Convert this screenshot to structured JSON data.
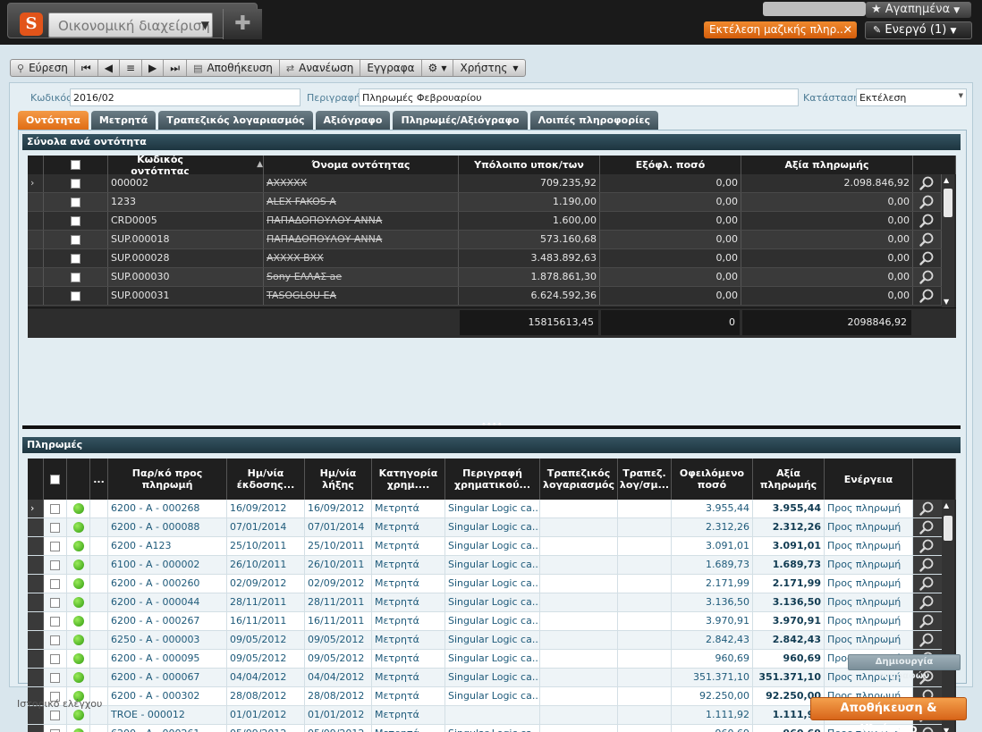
{
  "app": {
    "module_select": "Οικονομική διαχείριση",
    "favorites_label": "★ Αγαπημένα",
    "open_tab_label": "Εκτέλεση μαζικής πληρ...",
    "active_label": "Ενεργό (1)"
  },
  "toolbar": {
    "find": "Εύρεση",
    "save": "Αποθήκευση",
    "refresh": "Ανανέωση",
    "documents": "Εγγραφα",
    "user": "Χρήστης"
  },
  "form": {
    "code_label": "Κωδικός",
    "code_value": "2016/02",
    "desc_label": "Περιγραφή",
    "desc_value": "Πληρωμές Φεβρουαρίου",
    "status_label": "Κατάσταση",
    "status_value": "Εκτέλεση"
  },
  "tabs": [
    "Οντότητα",
    "Μετρητά",
    "Τραπεζικός λογαριασμός",
    "Αξιόγραφο",
    "Πληρωμές/Αξιόγραφο",
    "Λοιπές πληροφορίες"
  ],
  "entities": {
    "title": "Σύνολα ανά οντότητα",
    "columns": [
      "Κωδικός οντότητας",
      "Όνομα οντότητας",
      "Υπόλοιπο υποκ/των",
      "Εξόφλ. ποσό",
      "Αξία πληρωμής"
    ],
    "sort_indicator": "▲",
    "rows": [
      {
        "code": "000002",
        "name": "ΑΧΧΧΧΧ",
        "balance": "709.235,92",
        "paid": "0,00",
        "value": "2.098.846,92"
      },
      {
        "code": "1233",
        "name": "ALEX FAKOS A",
        "balance": "1.190,00",
        "paid": "0,00",
        "value": "0,00"
      },
      {
        "code": "CRD0005",
        "name": "ΠΑΠΑΔΟΠΟΥΛΟΥ ΑΝΝΑ",
        "balance": "1.600,00",
        "paid": "0,00",
        "value": "0,00"
      },
      {
        "code": "SUP.000018",
        "name": "ΠΑΠΑΔΟΠΟΥΛΟΥ ΑΝΝΑ",
        "balance": "573.160,68",
        "paid": "0,00",
        "value": "0,00"
      },
      {
        "code": "SUP.000028",
        "name": "ΑΧΧΧΧ ΒΧΧ",
        "balance": "3.483.892,63",
        "paid": "0,00",
        "value": "0,00"
      },
      {
        "code": "SUP.000030",
        "name": "Sony ΕΛΛΑΣ ae",
        "balance": "1.878.861,30",
        "paid": "0,00",
        "value": "0,00"
      },
      {
        "code": "SUP.000031",
        "name": "TASOGLOU EA",
        "balance": "6.624.592,36",
        "paid": "0,00",
        "value": "0,00"
      }
    ],
    "totals": {
      "balance": "15815613,45",
      "paid": "0",
      "value": "2098846,92"
    }
  },
  "payments": {
    "title": "Πληρωμές",
    "columns": {
      "ellipsis": "...",
      "ref": "Παρ/κό προς πληρωμή",
      "issue": "Ημ/νία έκδοσης...",
      "expiry": "Ημ/νία λήξης",
      "category": "Κατηγορία χρημ....",
      "description": "Περιγραφή χρηματικού...",
      "bank": "Τραπεζικός λογαριασμός",
      "bankdesc": "Τραπεζ. λογ/σμ...",
      "owed": "Οφειλόμενο ποσό",
      "value": "Αξία πληρωμής",
      "action": "Ενέργεια"
    },
    "rows": [
      {
        "ref": "6200 - A - 000268",
        "issue": "16/09/2012",
        "expiry": "16/09/2012",
        "category": "Μετρητά",
        "description": "Singular Logic ca...",
        "owed": "3.955,44",
        "value": "3.955,44",
        "action": "Προς πληρωμή"
      },
      {
        "ref": "6200 - A - 000088",
        "issue": "07/01/2014",
        "expiry": "07/01/2014",
        "category": "Μετρητά",
        "description": "Singular Logic ca...",
        "owed": "2.312,26",
        "value": "2.312,26",
        "action": "Προς πληρωμή"
      },
      {
        "ref": "6200 - A123",
        "issue": "25/10/2011",
        "expiry": "25/10/2011",
        "category": "Μετρητά",
        "description": "Singular Logic ca...",
        "owed": "3.091,01",
        "value": "3.091,01",
        "action": "Προς πληρωμή"
      },
      {
        "ref": "6100 - A - 000002",
        "issue": "26/10/2011",
        "expiry": "26/10/2011",
        "category": "Μετρητά",
        "description": "Singular Logic ca...",
        "owed": "1.689,73",
        "value": "1.689,73",
        "action": "Προς πληρωμή"
      },
      {
        "ref": "6200 - A - 000260",
        "issue": "02/09/2012",
        "expiry": "02/09/2012",
        "category": "Μετρητά",
        "description": "Singular Logic ca...",
        "owed": "2.171,99",
        "value": "2.171,99",
        "action": "Προς πληρωμή"
      },
      {
        "ref": "6200 - A - 000044",
        "issue": "28/11/2011",
        "expiry": "28/11/2011",
        "category": "Μετρητά",
        "description": "Singular Logic ca...",
        "owed": "3.136,50",
        "value": "3.136,50",
        "action": "Προς πληρωμή"
      },
      {
        "ref": "6200 - A - 000267",
        "issue": "16/11/2011",
        "expiry": "16/11/2011",
        "category": "Μετρητά",
        "description": "Singular Logic ca...",
        "owed": "3.970,91",
        "value": "3.970,91",
        "action": "Προς πληρωμή"
      },
      {
        "ref": "6250 - A - 000003",
        "issue": "09/05/2012",
        "expiry": "09/05/2012",
        "category": "Μετρητά",
        "description": "Singular Logic ca...",
        "owed": "2.842,43",
        "value": "2.842,43",
        "action": "Προς πληρωμή"
      },
      {
        "ref": "6200 - A - 000095",
        "issue": "09/05/2012",
        "expiry": "09/05/2012",
        "category": "Μετρητά",
        "description": "Singular Logic ca...",
        "owed": "960,69",
        "value": "960,69",
        "action": "Προς πληρωμή"
      },
      {
        "ref": "6200 - A - 000067",
        "issue": "04/04/2012",
        "expiry": "04/04/2012",
        "category": "Μετρητά",
        "description": "Singular Logic ca...",
        "owed": "351.371,10",
        "value": "351.371,10",
        "action": "Προς πληρωμή"
      },
      {
        "ref": "6200 - A - 000302",
        "issue": "28/08/2012",
        "expiry": "28/08/2012",
        "category": "Μετρητά",
        "description": "Singular Logic ca...",
        "owed": "92.250,00",
        "value": "92.250,00",
        "action": "Προς πληρωμή"
      },
      {
        "ref": "TROE - 000012",
        "issue": "01/01/2012",
        "expiry": "01/01/2012",
        "category": "Μετρητά",
        "description": "",
        "owed": "1.111,92",
        "value": "1.111,92",
        "action": "Προς πληρωμή"
      },
      {
        "ref": "6200 - A - 000261",
        "issue": "05/09/2012",
        "expiry": "05/09/2012",
        "category": "Μετρητά",
        "description": "Singular Logic ca...",
        "owed": "960,69",
        "value": "960,69",
        "action": "Προς πληρωμή"
      }
    ]
  },
  "footer": {
    "create_entries": "Δημιουργία εγγραφών",
    "audit_history": "Ιστορικό ελέγχου",
    "save_close": "Αποθήκευση & Κλείσιμο"
  },
  "colors": {
    "accent": "#e06d15",
    "header_dark": "#1d3540",
    "status_green": "#2f9a0e"
  }
}
